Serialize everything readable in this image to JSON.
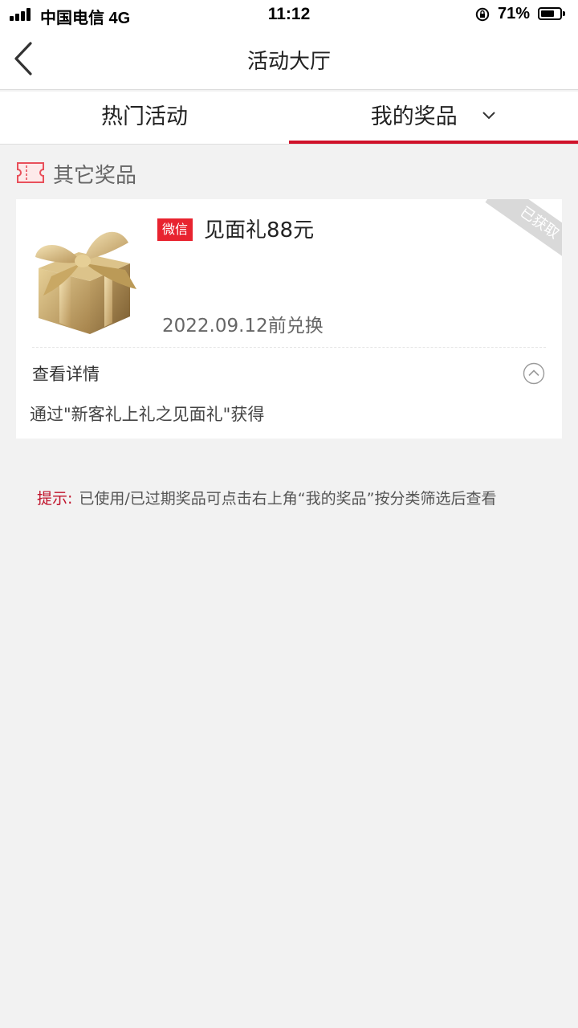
{
  "status_bar": {
    "carrier": "中国电信  4G",
    "time": "11:12",
    "battery_percent": "71%",
    "battery_level": 0.71
  },
  "nav": {
    "title": "活动大厅",
    "back_icon": "chevron-left-icon"
  },
  "tabs": [
    {
      "label": "热门活动",
      "active": false
    },
    {
      "label": "我的奖品",
      "active": true,
      "icon": "chevron-down-icon"
    }
  ],
  "section": {
    "title": "其它奖品",
    "icon": "ticket-icon"
  },
  "prize": {
    "badge": "微信",
    "name": "见面礼88元",
    "expiry": "2022.09.12前兑换",
    "status": "已获取",
    "details_label": "查看详情",
    "details_text": "通过\"新客礼上礼之见面礼\"获得",
    "image": "gift-box-image"
  },
  "tip": {
    "label": "提示:",
    "text": "已使用/已过期奖品可点击右上角“我的奖品”按分类筛选后查看"
  },
  "colors": {
    "accent": "#d0122a",
    "badge": "#e8232f",
    "background": "#f2f2f2"
  }
}
